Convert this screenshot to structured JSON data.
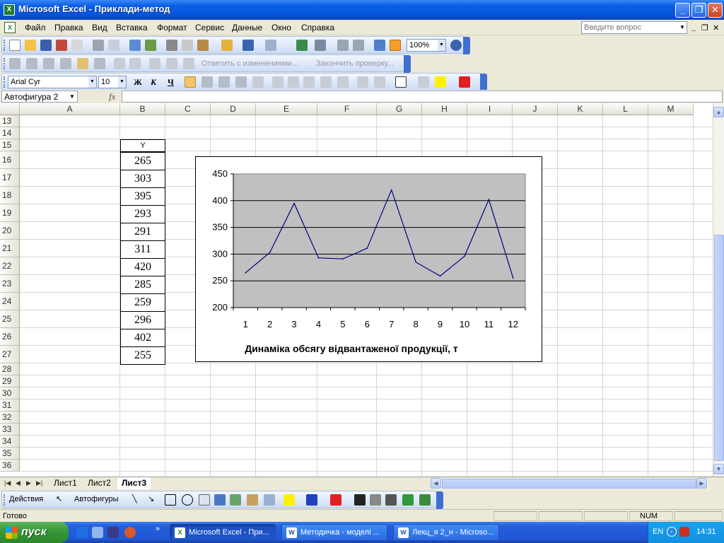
{
  "window": {
    "title": "Microsoft Excel - Приклади-метод",
    "app_icon": "X"
  },
  "menu": {
    "items": [
      "Файл",
      "Правка",
      "Вид",
      "Вставка",
      "Формат",
      "Сервис",
      "Данные",
      "Окно",
      "Справка"
    ],
    "help_placeholder": "Введите вопрос"
  },
  "toolbar_std": {
    "zoom": "100%"
  },
  "toolbar_review": {
    "reply_label": "Ответить с изменениями...",
    "end_review_label": "Закончить проверку..."
  },
  "toolbar_fmt": {
    "font": "Arial Cyr",
    "size": "10",
    "bold": "Ж",
    "italic": "К",
    "underline": "Ч"
  },
  "namebar": {
    "name": "Автофигура 2",
    "fx": "fx"
  },
  "grid": {
    "columns": [
      "A",
      "B",
      "C",
      "D",
      "E",
      "F",
      "G",
      "H",
      "I",
      "J",
      "K",
      "L",
      "M"
    ],
    "rows": [
      "13",
      "14",
      "15",
      "16",
      "17",
      "18",
      "19",
      "20",
      "21",
      "22",
      "23",
      "24",
      "25",
      "26",
      "27",
      "28",
      "29",
      "30",
      "31",
      "32",
      "33",
      "34",
      "35",
      "36"
    ],
    "y_header": "Y",
    "y_values": [
      "265",
      "303",
      "395",
      "293",
      "291",
      "311",
      "420",
      "285",
      "259",
      "296",
      "402",
      "255"
    ]
  },
  "chart_data": {
    "type": "line",
    "x": [
      1,
      2,
      3,
      4,
      5,
      6,
      7,
      8,
      9,
      10,
      11,
      12
    ],
    "categories": [
      "1",
      "2",
      "3",
      "4",
      "5",
      "6",
      "7",
      "8",
      "9",
      "10",
      "11",
      "12"
    ],
    "series": [
      {
        "values": [
          265,
          303,
          395,
          293,
          291,
          311,
          420,
          285,
          259,
          296,
          402,
          255
        ]
      }
    ],
    "title": "Динаміка обсягу відвантаженої продукції, т",
    "xlabel": "",
    "ylabel": "",
    "ylim": [
      200,
      450
    ],
    "yticks": [
      "200",
      "250",
      "300",
      "350",
      "400",
      "450"
    ],
    "grid": true,
    "plot_background": "#c0c0c0",
    "line_color": "#000080"
  },
  "sheets": {
    "tabs": [
      "Лист1",
      "Лист2",
      "Лист3"
    ],
    "active": "Лист3"
  },
  "drawbar": {
    "actions": "Действия",
    "autoshapes": "Автофигуры"
  },
  "status": {
    "ready": "Готово",
    "num": "NUM"
  },
  "taskbar": {
    "start": "пуск",
    "tasks": [
      "Microsoft Excel - При...",
      "Методичка - моделі ...",
      "Лекц_я 2_н - Microso..."
    ],
    "lang": "EN",
    "time": "14:31"
  },
  "colors": {
    "accent": "#0a5ee3",
    "chart_plot": "#c0c0c0",
    "chart_line": "#000080",
    "taskbar": "#245edb",
    "start": "#379a37"
  }
}
